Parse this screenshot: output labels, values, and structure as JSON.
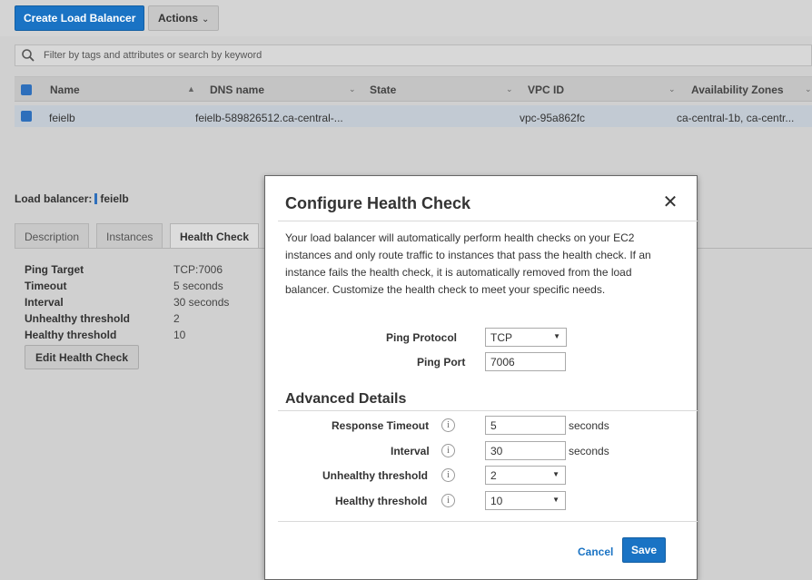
{
  "toolbar": {
    "create_label": "Create Load Balancer",
    "actions_label": "Actions"
  },
  "search": {
    "placeholder": "Filter by tags and attributes or search by keyword",
    "icon": "search-icon"
  },
  "grid": {
    "columns": [
      "Name",
      "DNS name",
      "State",
      "VPC ID",
      "Availability Zones"
    ],
    "rows": [
      {
        "name": "feielb",
        "dns": "feielb-589826512.ca-central-...",
        "state": "",
        "vpc": "vpc-95a862fc",
        "zones": "ca-central-1b, ca-centr..."
      }
    ]
  },
  "detail": {
    "label": "Load balancer:",
    "name": "feielb",
    "tabs": [
      "Description",
      "Instances",
      "Health Check"
    ],
    "active_tab": "Health Check",
    "fields": [
      {
        "key": "Ping Target",
        "value": "TCP:7006"
      },
      {
        "key": "Timeout",
        "value": "5 seconds"
      },
      {
        "key": "Interval",
        "value": "30 seconds"
      },
      {
        "key": "Unhealthy threshold",
        "value": "2"
      },
      {
        "key": "Healthy threshold",
        "value": "10"
      }
    ],
    "edit_label": "Edit Health Check"
  },
  "modal": {
    "title": "Configure Health Check",
    "description": "Your load balancer will automatically perform health checks on your EC2 instances and only route traffic to instances that pass the health check. If an instance fails the health check, it is automatically removed from the load balancer. Customize the health check to meet your specific needs.",
    "ping_protocol_label": "Ping Protocol",
    "ping_protocol_value": "TCP",
    "ping_port_label": "Ping Port",
    "ping_port_value": "7006",
    "advanced_title": "Advanced Details",
    "response_timeout_label": "Response Timeout",
    "response_timeout_value": "5",
    "interval_label": "Interval",
    "interval_value": "30",
    "unhealthy_label": "Unhealthy threshold",
    "unhealthy_value": "2",
    "healthy_label": "Healthy threshold",
    "healthy_value": "10",
    "seconds_unit": "seconds",
    "info_glyph": "i",
    "cancel_label": "Cancel",
    "save_label": "Save"
  },
  "colors": {
    "primary": "#1a73c4",
    "overlay": "#d0d0d0",
    "selected_row": "#c2cad3"
  }
}
